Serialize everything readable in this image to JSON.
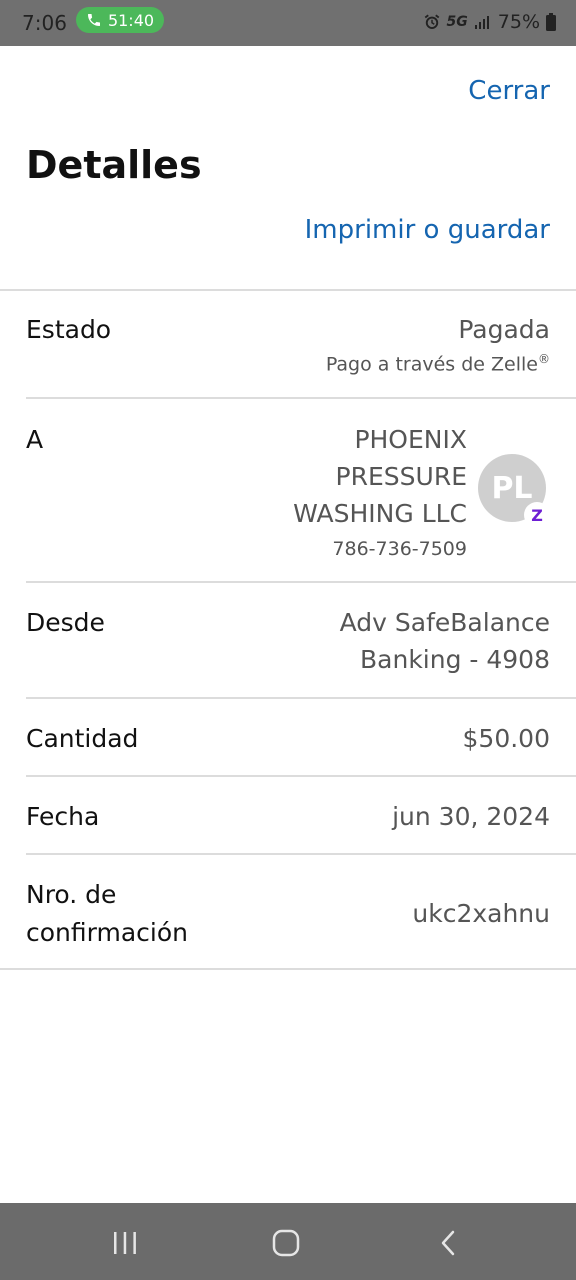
{
  "status_bar": {
    "time": "7:06",
    "call_timer": "51:40",
    "network": "5G",
    "battery": "75%",
    "icons": [
      "phone-icon",
      "alarm-icon",
      "signal-icon",
      "battery-icon"
    ]
  },
  "header": {
    "close_label": "Cerrar",
    "title": "Detalles",
    "print_label": "Imprimir o guardar"
  },
  "details": {
    "status": {
      "label": "Estado",
      "value": "Pagada",
      "sub_value": "Pago a través de Zelle",
      "sub_mark": "®"
    },
    "recipient": {
      "label": "A",
      "name_lines": [
        "PHOENIX",
        "PRESSURE",
        "WASHING LLC"
      ],
      "phone": "786-736-7509",
      "avatar_initials": "PL",
      "badge_letter": "Z"
    },
    "from": {
      "label": "Desde",
      "value_lines": [
        "Adv SafeBalance",
        "Banking - 4908"
      ]
    },
    "amount": {
      "label": "Cantidad",
      "value": "$50.00"
    },
    "date": {
      "label": "Fecha",
      "value": "jun 30, 2024"
    },
    "confirmation": {
      "label_lines": [
        "Nro. de",
        "confirmación"
      ],
      "value": "ukc2xahnu"
    }
  },
  "colors": {
    "link": "#1565b0",
    "status_bar": "#707070",
    "call_pill": "#4cb85a",
    "zelle_purple": "#6d1ed4"
  },
  "nav_icons": [
    "recent-apps-icon",
    "home-icon",
    "back-icon"
  ]
}
